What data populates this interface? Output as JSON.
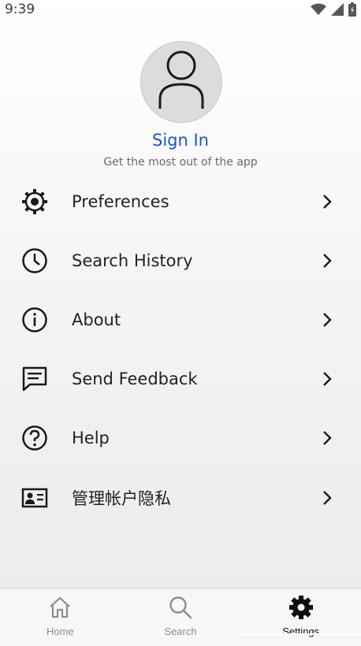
{
  "status_bar": {
    "time": "9:39",
    "icons": [
      "wifi-icon",
      "signal-icon",
      "battery-icon"
    ]
  },
  "profile": {
    "avatar_icon": "person-icon",
    "sign_in_label": "Sign In",
    "subtitle": "Get the most out of the app"
  },
  "menu": {
    "items": [
      {
        "label": "Preferences",
        "icon": "gear-icon"
      },
      {
        "label": "Search History",
        "icon": "clock-icon"
      },
      {
        "label": "About",
        "icon": "info-icon"
      },
      {
        "label": "Send Feedback",
        "icon": "feedback-icon"
      },
      {
        "label": "Help",
        "icon": "help-icon"
      },
      {
        "label": "管理帐户隐私",
        "icon": "id-card-icon"
      }
    ]
  },
  "bottom_nav": {
    "items": [
      {
        "label": "Home",
        "icon": "home-icon",
        "active": false
      },
      {
        "label": "Search",
        "icon": "search-icon",
        "active": false
      },
      {
        "label": "Settings",
        "icon": "settings-gear-icon",
        "active": true
      }
    ]
  },
  "colors": {
    "accent": "#1a56c4",
    "text": "#222222",
    "muted": "#6a6a6a",
    "nav_inactive": "#8e8e8e"
  }
}
